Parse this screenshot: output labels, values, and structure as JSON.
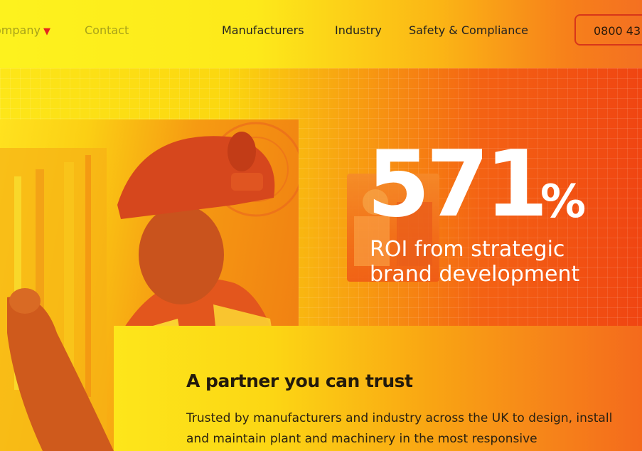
{
  "header": {
    "nav": {
      "company_label": "ompany",
      "contact_label": "Contact",
      "manufacturers_label": "Manufacturers",
      "industry_label": "Industry",
      "safety_label": "Safety & Compliance"
    },
    "phone_label": "0800 43",
    "caret_icon": "caret-down-icon",
    "colors": {
      "accent": "#e5261e"
    }
  },
  "hero": {
    "stat_number": "571",
    "stat_suffix": "%",
    "stat_caption_line1": "ROI from strategic",
    "stat_caption_line2": "brand development"
  },
  "content": {
    "title": "A partner you can trust",
    "body": "Trusted by manufacturers and industry across the UK to design, install and maintain plant and machinery in the most responsive"
  }
}
